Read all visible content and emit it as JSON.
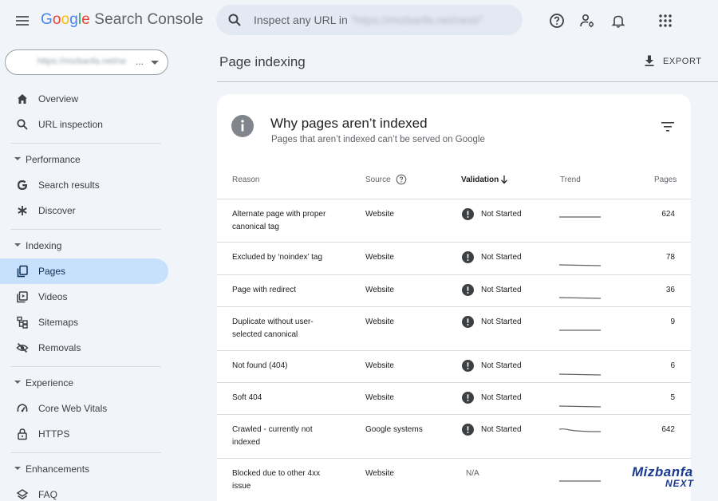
{
  "header": {
    "logo_google": [
      "G",
      "o",
      "o",
      "g",
      "l",
      "e"
    ],
    "logo_product": "Search Console",
    "search_placeholder": "Inspect any URL in",
    "search_property": "\"https://mizbanfa.net/next/\""
  },
  "sidebar": {
    "property": "https://mizbanfa.net/ne",
    "property_ellipsis": "...",
    "items_top": [
      {
        "label": "Overview",
        "icon": "home-icon"
      },
      {
        "label": "URL inspection",
        "icon": "search-icon"
      }
    ],
    "sections": [
      {
        "label": "Performance",
        "items": [
          {
            "label": "Search results",
            "icon": "google-g-icon"
          },
          {
            "label": "Discover",
            "icon": "asterisk-icon"
          }
        ]
      },
      {
        "label": "Indexing",
        "items": [
          {
            "label": "Pages",
            "icon": "pages-icon",
            "active": true
          },
          {
            "label": "Videos",
            "icon": "video-icon"
          },
          {
            "label": "Sitemaps",
            "icon": "sitemap-icon"
          },
          {
            "label": "Removals",
            "icon": "eye-off-icon"
          }
        ]
      },
      {
        "label": "Experience",
        "items": [
          {
            "label": "Core Web Vitals",
            "icon": "speed-icon"
          },
          {
            "label": "HTTPS",
            "icon": "lock-icon"
          }
        ]
      },
      {
        "label": "Enhancements",
        "items": [
          {
            "label": "FAQ",
            "icon": "layers-icon"
          }
        ]
      }
    ]
  },
  "main": {
    "title": "Page indexing",
    "export_label": "EXPORT"
  },
  "card": {
    "title": "Why pages aren’t indexed",
    "subtitle": "Pages that aren’t indexed can’t be served on Google",
    "columns": {
      "reason": "Reason",
      "source": "Source",
      "validation": "Validation",
      "trend": "Trend",
      "pages": "Pages"
    },
    "rows": [
      {
        "reason": "Alternate page with proper canonical tag",
        "source": "Website",
        "validation": "Not Started",
        "pages": "624"
      },
      {
        "reason": "Excluded by ‘noindex’ tag",
        "source": "Website",
        "validation": "Not Started",
        "pages": "78"
      },
      {
        "reason": "Page with redirect",
        "source": "Website",
        "validation": "Not Started",
        "pages": "36"
      },
      {
        "reason": "Duplicate without user-selected canonical",
        "source": "Website",
        "validation": "Not Started",
        "pages": "9"
      },
      {
        "reason": "Not found (404)",
        "source": "Website",
        "validation": "Not Started",
        "pages": "6"
      },
      {
        "reason": "Soft 404",
        "source": "Website",
        "validation": "Not Started",
        "pages": "5"
      },
      {
        "reason": "Crawled - currently not indexed",
        "source": "Google systems",
        "validation": "Not Started",
        "pages": "642"
      },
      {
        "reason": "Blocked due to other 4xx issue",
        "source": "Website",
        "validation": "N/A",
        "pages": ""
      }
    ]
  },
  "watermark": {
    "line1": "Mizbanfa",
    "line2": "NEXT"
  },
  "colors": {
    "accent": "#1a73e8",
    "active_bg": "#c7e0fb",
    "status_icon": "#3c4043"
  }
}
